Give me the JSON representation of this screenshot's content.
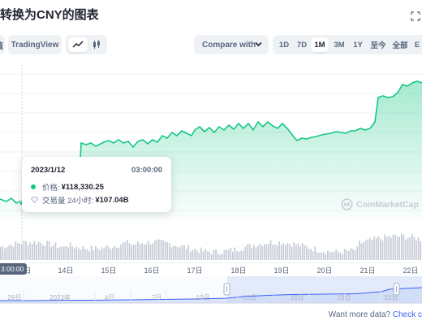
{
  "title": "转换为CNY的图表",
  "toolbar": {
    "left_tab_partial": "值",
    "tradingview_label": "TradingView",
    "compare_label": "Compare with",
    "ranges": [
      "1D",
      "7D",
      "1M",
      "3M",
      "1Y",
      "至今",
      "全部"
    ],
    "active_range": "1M",
    "last_partial": "E"
  },
  "tooltip": {
    "date": "2023/1/12",
    "time": "03:00:00",
    "price_label": "价格:",
    "price_value": "¥118,330.25",
    "volume_label": "交易量 24小时:",
    "volume_value": "¥107.04B",
    "price_dot_color": "#16c784"
  },
  "watermark": "CoinMarketCap",
  "time_badge": "3:00:00",
  "x_axis_labels": [
    "14日",
    "15日",
    "16日",
    "17日",
    "18日",
    "19日",
    "20日",
    "21日",
    "22日"
  ],
  "x_axis_partial_left": "日",
  "navigator_labels": [
    "29日",
    "2023年",
    "4日",
    "7日",
    "10日",
    "13日",
    "16日",
    "19日",
    "22日"
  ],
  "footer": {
    "text": "Want more data?",
    "link_partial": "Check c"
  },
  "colors": {
    "accent_green": "#16c784",
    "line_green": "#16c784",
    "nav_line": "#3861fb",
    "nav_fill": "#dbe6fb"
  }
}
